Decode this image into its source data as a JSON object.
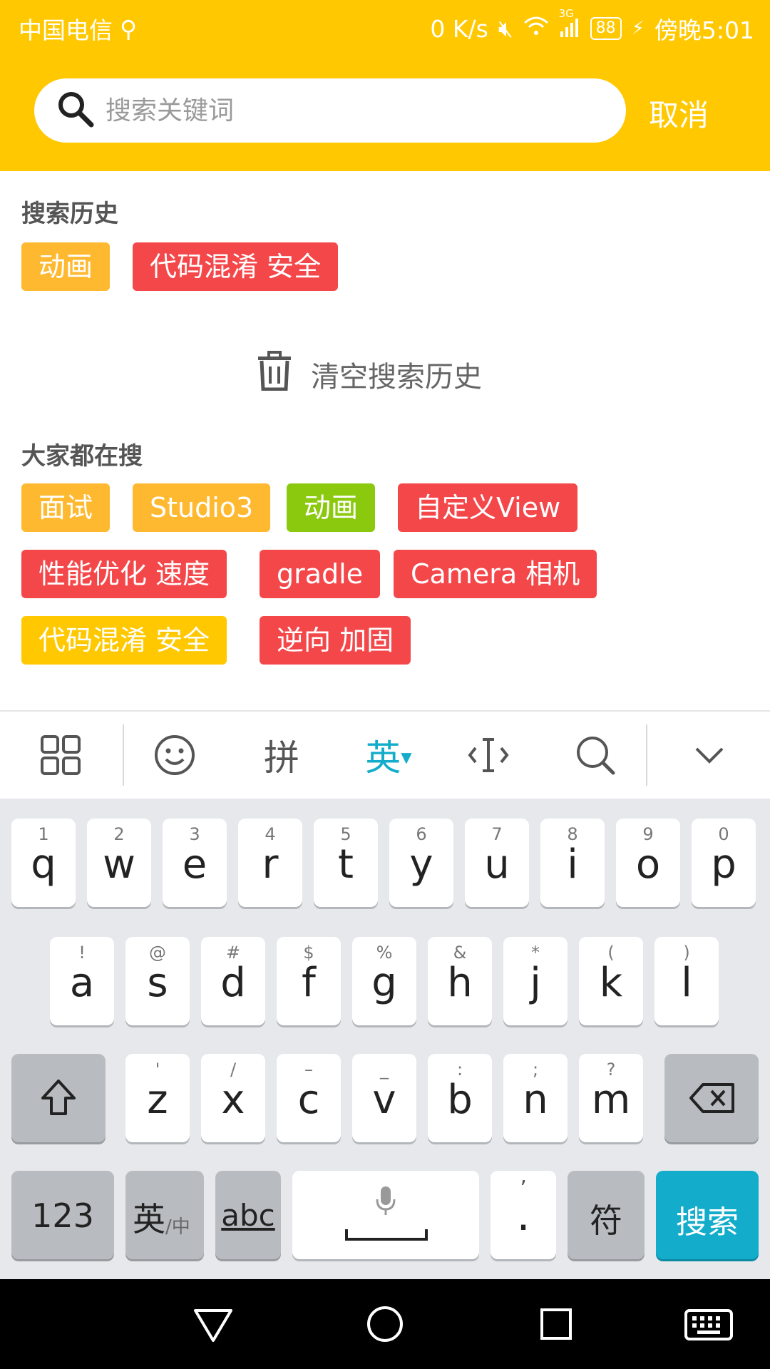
{
  "status_bar": {
    "carrier": "中国电信",
    "net_speed": "0 K/s",
    "network": "3G",
    "battery": "88",
    "time": "傍晚5:01"
  },
  "search": {
    "placeholder": "搜索关键词",
    "cancel_label": "取消"
  },
  "history": {
    "title": "搜索历史",
    "tags": [
      {
        "label": "动画",
        "color": "#FFB930"
      },
      {
        "label": "代码混淆 安全",
        "color": "#F4474A"
      }
    ],
    "clear_label": "清空搜索历史"
  },
  "popular": {
    "title": "大家都在搜",
    "tags": [
      {
        "label": "面试",
        "color": "#FFB930"
      },
      {
        "label": "Studio3",
        "color": "#FFB930"
      },
      {
        "label": "动画",
        "color": "#8BC90F"
      },
      {
        "label": "自定义View",
        "color": "#F4474A"
      },
      {
        "label": "性能优化 速度",
        "color": "#F4474A"
      },
      {
        "label": "gradle",
        "color": "#F4474A"
      },
      {
        "label": "Camera 相机",
        "color": "#F4474A"
      },
      {
        "label": "代码混淆 安全",
        "color": "#FFC800"
      },
      {
        "label": "逆向 加固",
        "color": "#F4474A"
      }
    ]
  },
  "keyboard": {
    "toolbar": {
      "pinyin": "拼",
      "english": "英"
    },
    "row1": [
      {
        "top": "1",
        "key": "q"
      },
      {
        "top": "2",
        "key": "w"
      },
      {
        "top": "3",
        "key": "e"
      },
      {
        "top": "4",
        "key": "r"
      },
      {
        "top": "5",
        "key": "t"
      },
      {
        "top": "6",
        "key": "y"
      },
      {
        "top": "7",
        "key": "u"
      },
      {
        "top": "8",
        "key": "i"
      },
      {
        "top": "9",
        "key": "o"
      },
      {
        "top": "0",
        "key": "p"
      }
    ],
    "row2": [
      {
        "top": "!",
        "key": "a"
      },
      {
        "top": "@",
        "key": "s"
      },
      {
        "top": "#",
        "key": "d"
      },
      {
        "top": "$",
        "key": "f"
      },
      {
        "top": "%",
        "key": "g"
      },
      {
        "top": "&",
        "key": "h"
      },
      {
        "top": "*",
        "key": "j"
      },
      {
        "top": "(",
        "key": "k"
      },
      {
        "top": ")",
        "key": "l"
      }
    ],
    "row3": [
      {
        "top": "'",
        "key": "z"
      },
      {
        "top": "/",
        "key": "x"
      },
      {
        "top": "–",
        "key": "c"
      },
      {
        "top": "_",
        "key": "v"
      },
      {
        "top": ":",
        "key": "b"
      },
      {
        "top": ";",
        "key": "n"
      },
      {
        "top": "?",
        "key": "m"
      }
    ],
    "numbers_label": "123",
    "lang_label": "英",
    "lang_sub": "/中",
    "abc_label": "abc",
    "punct_top": "’",
    "punct_key": ".",
    "symbols_label": "符",
    "search_label": "搜索"
  }
}
